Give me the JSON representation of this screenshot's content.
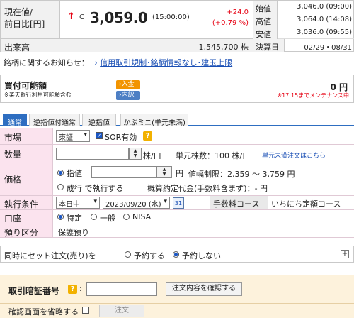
{
  "quote": {
    "label1": "現在値/",
    "label2": "前日比[円]",
    "arrow": "↑",
    "mark": "C",
    "price": "3,059.0",
    "price_time": "(15:00:00)",
    "change": "+24.0",
    "change_pct": "(+0.79 %)",
    "volume_label": "出来高",
    "volume_value": "1,545,700 株",
    "open_label": "始値",
    "open_value": "3,046.0 (09:00)",
    "high_label": "高値",
    "high_value": "3,064.0 (14:08)",
    "low_label": "安値",
    "low_value": "3,036.0 (09:55)",
    "settle_label": "決算日",
    "settle_value": "02/29・08/31"
  },
  "notice": {
    "label": "銘柄に関するお知らせ：",
    "link": "信用取引規制･銘柄情報なし･建玉上限"
  },
  "buying_power": {
    "title": "買付可能額",
    "sub": "※楽天銀行利用可能額含む",
    "deposit_label": "入金",
    "detail_label": "内訳",
    "value": "0 円",
    "note": "※17:15までメンテナンス中"
  },
  "tabs": [
    "通常",
    "逆指値付通常",
    "逆指値",
    "かぶミニ(単元未満)"
  ],
  "form": {
    "market_label": "市場",
    "market_value": "東証",
    "sor_label": "SOR有効",
    "qty_label": "数量",
    "qty_unit": "株/口",
    "unit_shares": "単元株数：100 株/口",
    "odd_lot_link": "単元未満注文はこちら",
    "price_label": "価格",
    "limit_label": "指値",
    "price_unit": "円",
    "price_range": "値幅制限：2,359 ～ 3,759 円",
    "market_order_label": "成行 で執行する",
    "est_amount": "概算約定代金(手数料含まず)：- 円",
    "cond_label": "執行条件",
    "cond_value": "本日中",
    "date_value": "2023/09/20 (水)",
    "fee_label": "手数料コース",
    "fee_value": "いちにち定額コース",
    "account_label": "口座",
    "acct_specific": "特定",
    "acct_general": "一般",
    "acct_nisa": "NISA",
    "custody_label": "預り区分",
    "custody_value": "保護預り"
  },
  "set_order": {
    "label": "同時にセット注文(売り)を",
    "opt_yes": "予約する",
    "opt_no": "予約しない"
  },
  "password": {
    "label": "取引暗証番号",
    "confirm_button": "注文内容を確認する",
    "skip_label": "確認画面を省略する",
    "order_button": "注文"
  }
}
